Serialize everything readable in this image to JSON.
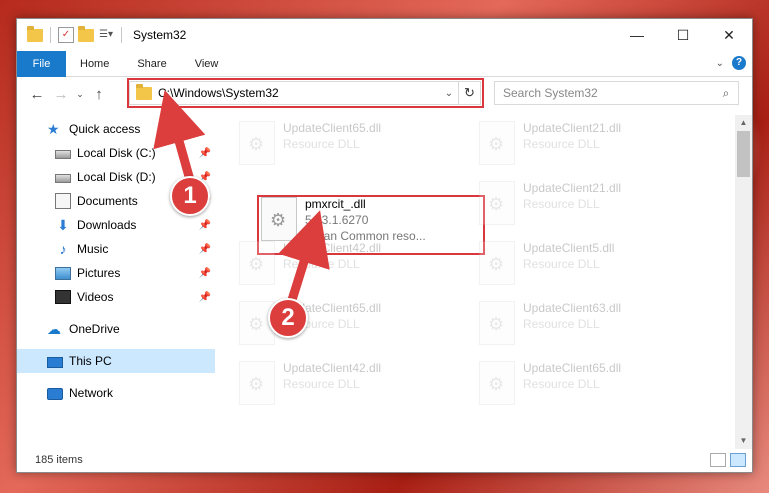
{
  "window": {
    "title": "System32",
    "controls": {
      "minimize": "—",
      "maximize": "☐",
      "close": "✕"
    }
  },
  "ribbon": {
    "tabs": [
      "File",
      "Home",
      "Share",
      "View"
    ]
  },
  "address": {
    "path": "C:\\Windows\\System32",
    "search_placeholder": "Search System32"
  },
  "nav": {
    "items": [
      {
        "label": "Quick access",
        "icon": "star-icon",
        "pinned": false
      },
      {
        "label": "Local Disk (C:)",
        "icon": "disk-icon",
        "pinned": true
      },
      {
        "label": "Local Disk (D:)",
        "icon": "disk-icon",
        "pinned": true
      },
      {
        "label": "Documents",
        "icon": "documents-icon",
        "pinned": true
      },
      {
        "label": "Downloads",
        "icon": "downloads-icon",
        "pinned": true
      },
      {
        "label": "Music",
        "icon": "music-icon",
        "pinned": true
      },
      {
        "label": "Pictures",
        "icon": "pictures-icon",
        "pinned": true
      },
      {
        "label": "Videos",
        "icon": "videos-icon",
        "pinned": true
      },
      {
        "label": "OneDrive",
        "icon": "cloud-icon",
        "pinned": false
      },
      {
        "label": "This PC",
        "icon": "pc-icon",
        "pinned": false,
        "selected": true
      },
      {
        "label": "Network",
        "icon": "network-icon",
        "pinned": false
      }
    ]
  },
  "files": {
    "highlighted": {
      "name": "pmxrcit_.dll",
      "version": "5.13.1.6270",
      "description": "Italian Common reso..."
    },
    "items": [
      {
        "name": "UpdateClient65.dll",
        "sub": "Resource DLL"
      },
      {
        "name": "UpdateClient21.dll",
        "sub": "Resource DLL"
      },
      {
        "name": "UpdateClient21.dll",
        "sub": "Resource DLL"
      },
      {
        "name": "UpdateClient42.dll",
        "sub": "Resource DLL"
      },
      {
        "name": "UpdateClient5.dll",
        "sub": "Resource DLL"
      },
      {
        "name": "UpdateClient65.dll",
        "sub": "Resource DLL"
      },
      {
        "name": "UpdateClient63.dll",
        "sub": "Resource DLL"
      },
      {
        "name": "UpdateClient42.dll",
        "sub": "Resource DLL"
      },
      {
        "name": "UpdateClient65.dll",
        "sub": "Resource DLL"
      }
    ]
  },
  "status": {
    "item_count": "185 items"
  },
  "callouts": [
    "1",
    "2"
  ],
  "colors": {
    "accent": "#1979ca",
    "highlight": "#d9363e",
    "selected": "#cce8ff"
  }
}
